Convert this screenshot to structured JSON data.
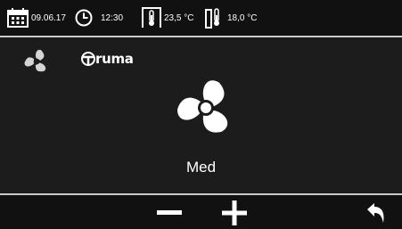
{
  "status_bar": {
    "date": "09.06.17",
    "time": "12:30",
    "indoor_temp": "23,5 °C",
    "outdoor_temp": "18,0 °C",
    "icons": [
      "calendar-icon",
      "clock-icon",
      "indoor-thermometer-icon",
      "outdoor-thermometer-icon"
    ]
  },
  "main": {
    "mode_icon": "fan-icon",
    "brand": "ruma",
    "fan_level": "Med"
  },
  "bottom_bar": {
    "buttons": [
      "minus-icon",
      "plus-icon",
      "back-arrow-icon"
    ]
  },
  "colors": {
    "background": "#1c1c1c",
    "bar": "#111111",
    "separator": "#c9c9c9",
    "foreground": "#ffffff"
  }
}
